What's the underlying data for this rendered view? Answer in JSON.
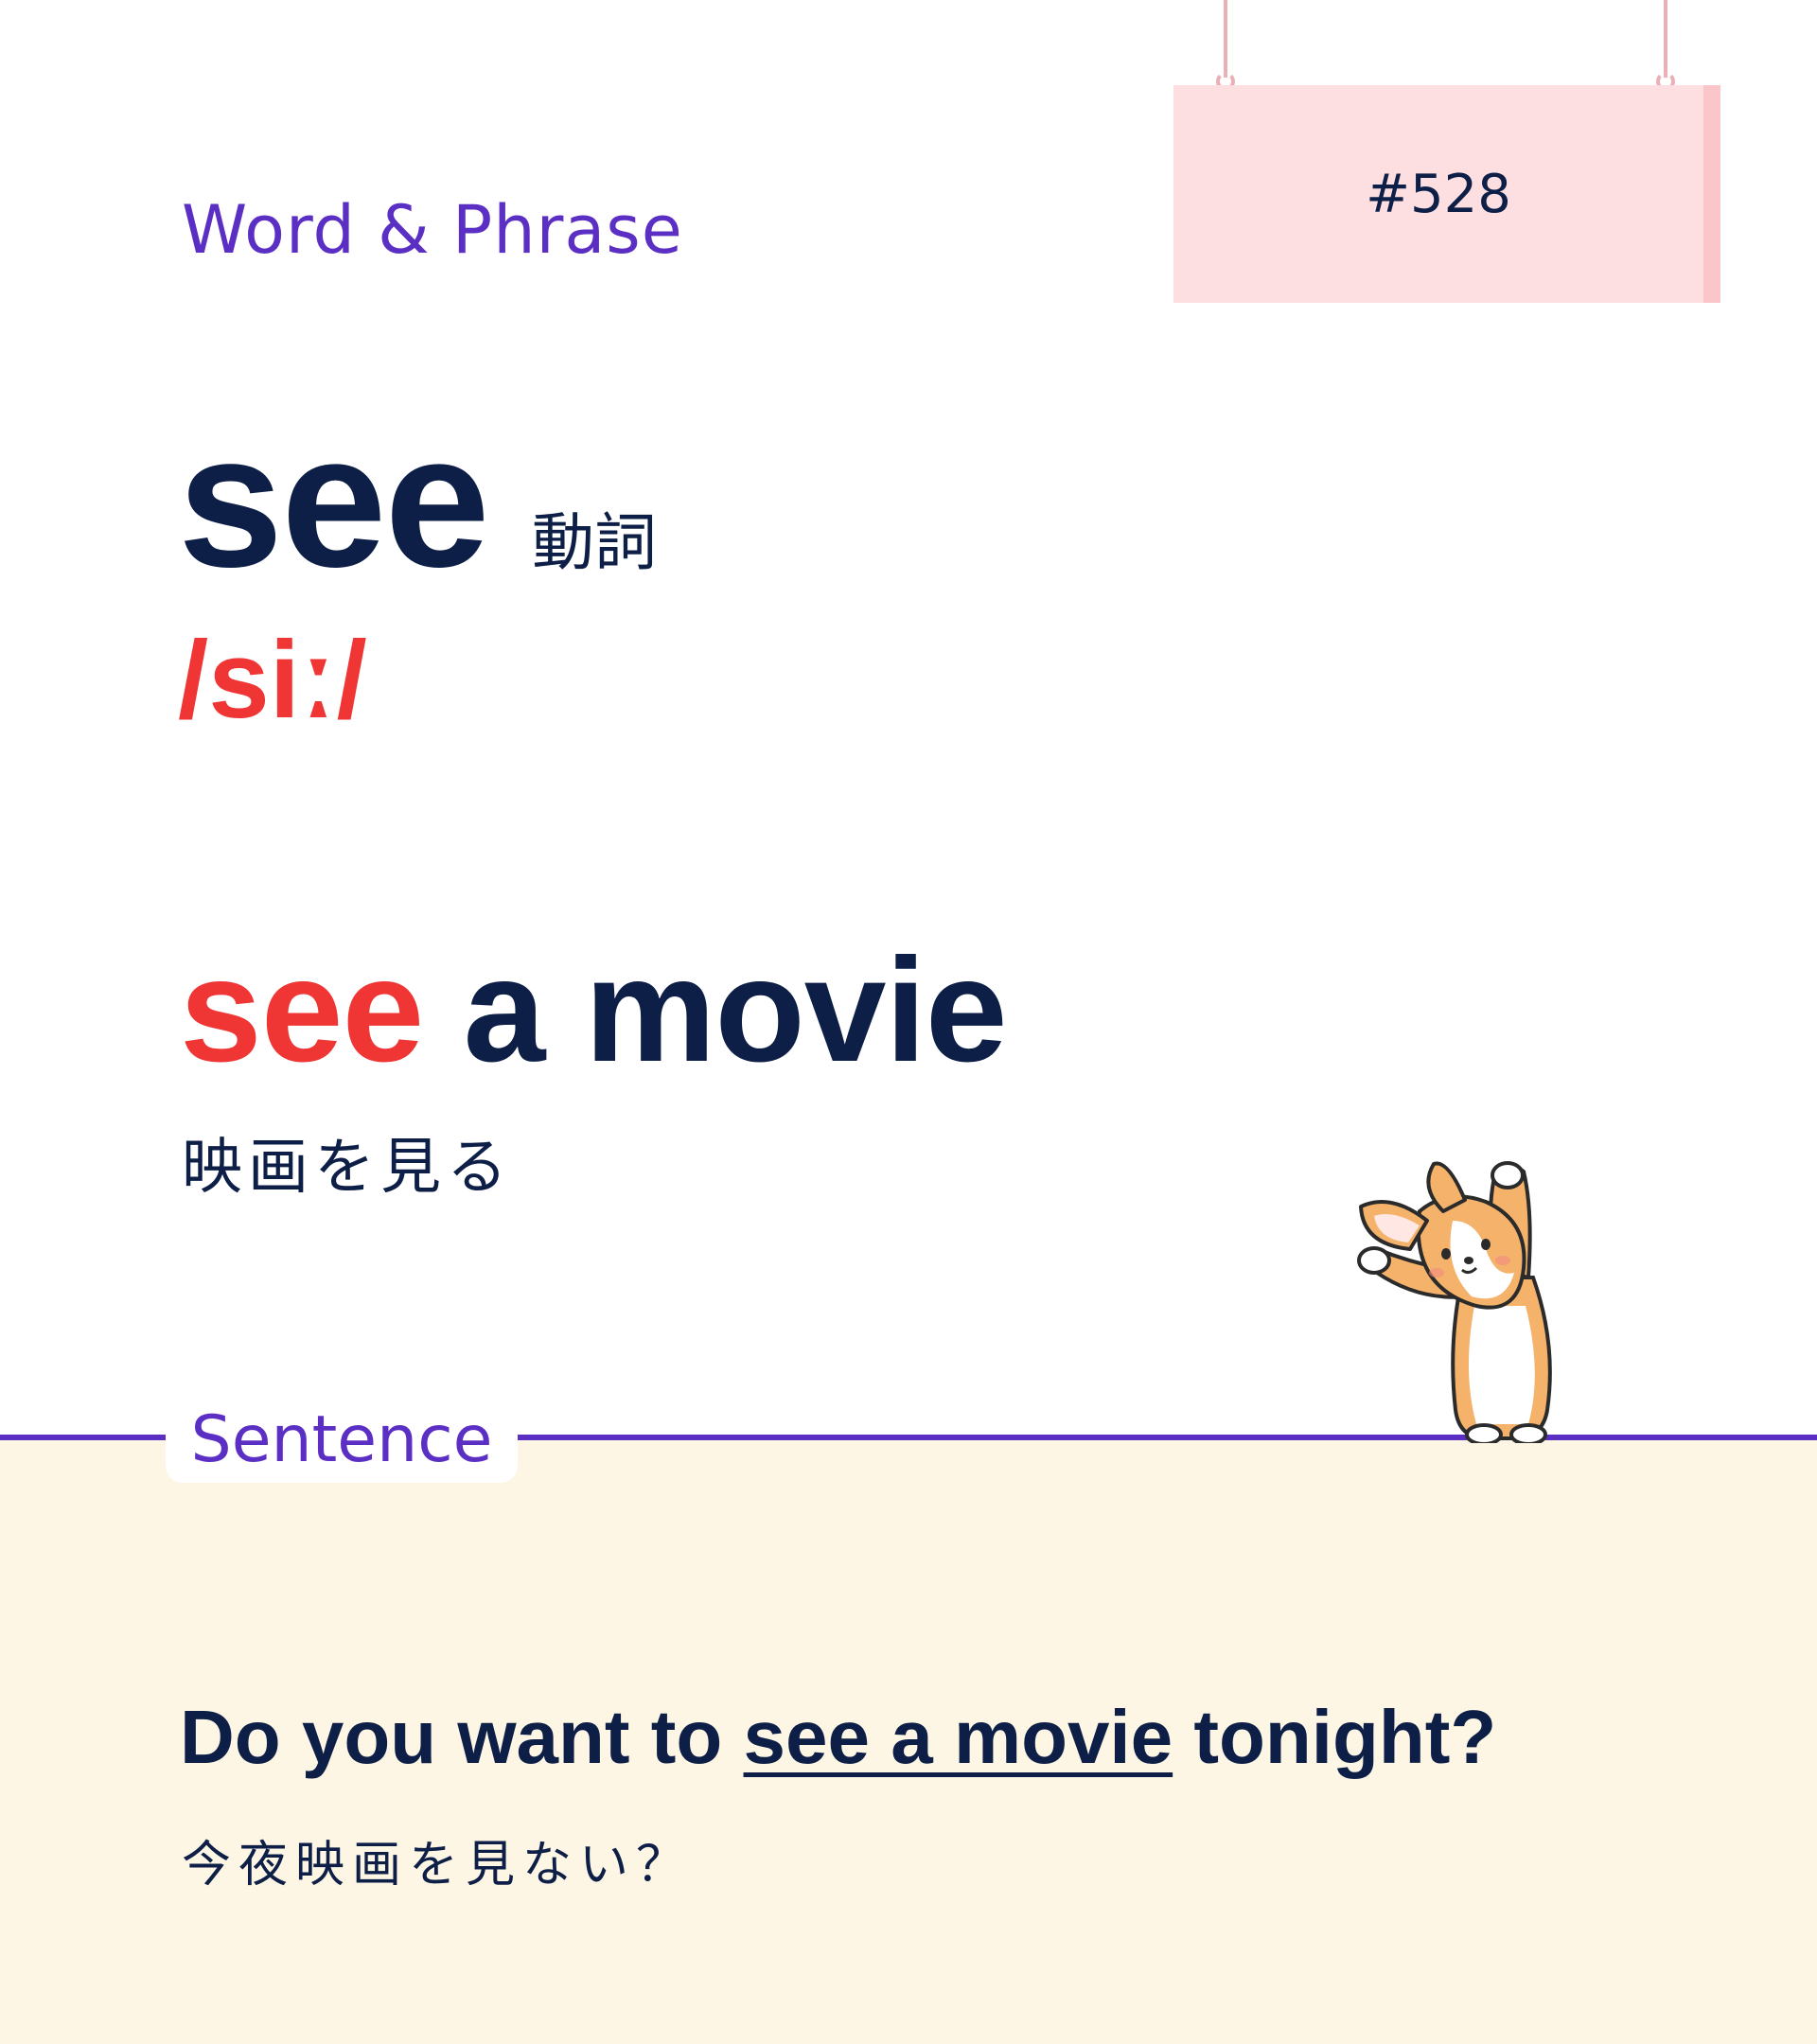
{
  "header": {
    "section_label": "Word & Phrase",
    "card_number": "#528"
  },
  "word": {
    "headword": "see",
    "part_of_speech": "動詞",
    "pronunciation": "/siː/"
  },
  "phrase": {
    "highlight": "see",
    "rest": " a movie",
    "translation": "映画を見る"
  },
  "sentence_section": {
    "label": "Sentence",
    "sentence_before": "Do you want to ",
    "sentence_underlined": "see a movie",
    "sentence_after": " tonight?",
    "translation": "今夜映画を見ない？"
  },
  "mascot": {
    "icon": "corgi-stretching-icon"
  },
  "colors": {
    "accent_purple": "#5b2fc4",
    "highlight_red": "#f03535",
    "text_navy": "#0d1f47",
    "sign_pink": "#fddfe2",
    "bottom_cream": "#fdf6e4"
  }
}
